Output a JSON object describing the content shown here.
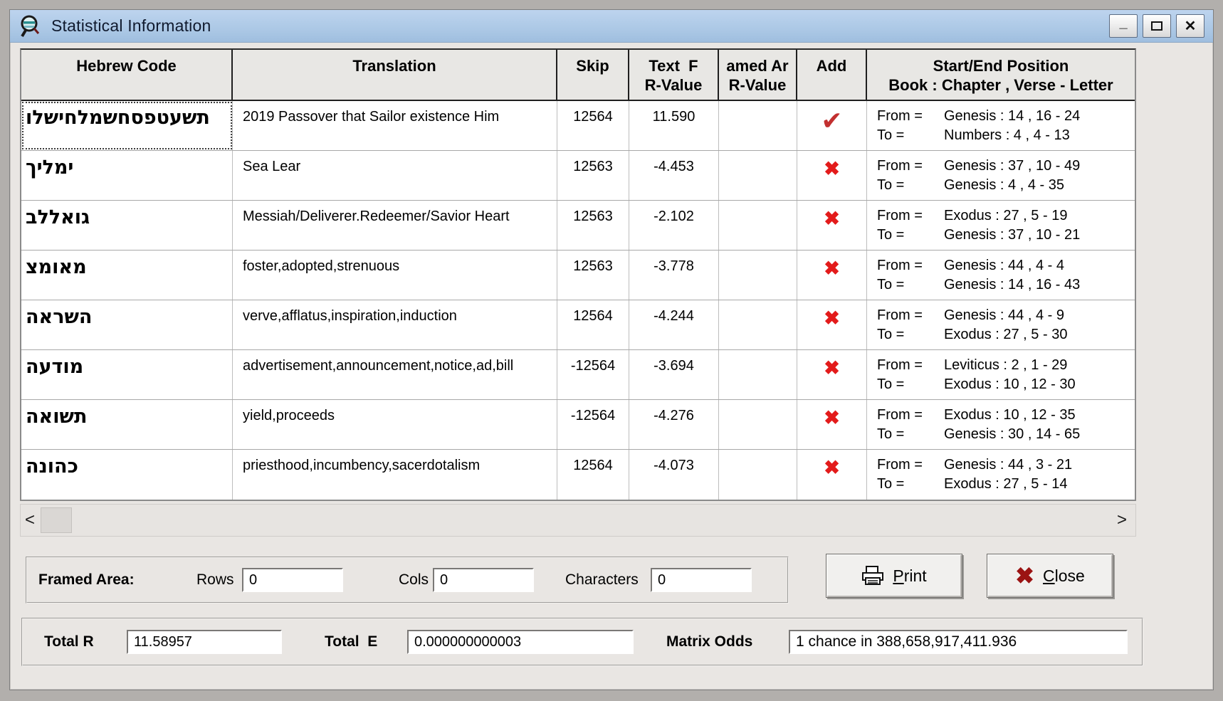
{
  "window": {
    "title": "Statistical Information",
    "controls": {
      "minimize": "_",
      "close": "✕"
    }
  },
  "table": {
    "headers": {
      "hebrew_code": "Hebrew Code",
      "translation": "Translation",
      "skip": "Skip",
      "text_r_line1": "Text  F",
      "text_r_line2": "R-Value",
      "framed_r_line1": "amed Ar",
      "framed_r_line2": "R-Value",
      "add": "Add",
      "position_line1": "Start/End Position",
      "position_line2": "Book : Chapter , Verse - Letter"
    },
    "from_label": "From =",
    "to_label": "To =",
    "rows": [
      {
        "hebrew": "תשעטפסחשמלחישלו",
        "translation": "2019 Passover that Sailor existence Him",
        "skip": "12564",
        "text_r": "11.590",
        "framed_r": "",
        "add_glyph": "✔",
        "add_type": "check",
        "from": "Genesis : 14 , 16 - 24",
        "to": "Numbers : 4 , 4 - 13"
      },
      {
        "hebrew": "ימליך",
        "translation": "Sea Lear",
        "skip": "12563",
        "text_r": "-4.453",
        "framed_r": "",
        "add_glyph": "✖",
        "add_type": "cross",
        "from": "Genesis : 37 , 10 - 49",
        "to": "Genesis : 4 , 4 - 35"
      },
      {
        "hebrew": "גואללב",
        "translation": "Messiah/Deliverer.Redeemer/Savior Heart",
        "skip": "12563",
        "text_r": "-2.102",
        "framed_r": "",
        "add_glyph": "✖",
        "add_type": "cross",
        "from": "Exodus : 27 , 5 - 19",
        "to": "Genesis : 37 , 10 - 21"
      },
      {
        "hebrew": "מאומצ",
        "translation": "foster,adopted,strenuous",
        "skip": "12563",
        "text_r": "-3.778",
        "framed_r": "",
        "add_glyph": "✖",
        "add_type": "cross",
        "from": "Genesis : 44 , 4 - 4",
        "to": "Genesis : 14 , 16 - 43"
      },
      {
        "hebrew": "השראה",
        "translation": "verve,afflatus,inspiration,induction",
        "skip": "12564",
        "text_r": "-4.244",
        "framed_r": "",
        "add_glyph": "✖",
        "add_type": "cross",
        "from": "Genesis : 44 , 4 - 9",
        "to": "Exodus : 27 , 5 - 30"
      },
      {
        "hebrew": "מודעה",
        "translation": "advertisement,announcement,notice,ad,bill",
        "skip": "-12564",
        "text_r": "-3.694",
        "framed_r": "",
        "add_glyph": "✖",
        "add_type": "cross",
        "from": "Leviticus : 2 , 1 - 29",
        "to": "Exodus : 10 , 12 - 30"
      },
      {
        "hebrew": "תשואה",
        "translation": "yield,proceeds",
        "skip": "-12564",
        "text_r": "-4.276",
        "framed_r": "",
        "add_glyph": "✖",
        "add_type": "cross",
        "from": "Exodus : 10 , 12 - 35",
        "to": "Genesis : 30 , 14 - 65"
      },
      {
        "hebrew": "כהונה",
        "translation": "priesthood,incumbency,sacerdotalism",
        "skip": "12564",
        "text_r": "-4.073",
        "framed_r": "",
        "add_glyph": "✖",
        "add_type": "cross",
        "from": "Genesis : 44 , 3 - 21",
        "to": "Exodus : 27 , 5 - 14"
      }
    ]
  },
  "scrollbar": {
    "left_arrow": "<",
    "right_arrow": ">"
  },
  "framed_area": {
    "label": "Framed Area:",
    "rows_label": "Rows",
    "rows_value": "0",
    "cols_label": "Cols",
    "cols_value": "0",
    "chars_label": "Characters",
    "chars_value": "0"
  },
  "buttons": {
    "print": "Print",
    "close": "Close",
    "close_icon": "✖"
  },
  "totals": {
    "total_r_label": "Total R",
    "total_r_value": "11.58957",
    "total_e_label": "Total  E",
    "total_e_value": "0.000000000003",
    "matrix_odds_label": "Matrix Odds",
    "matrix_odds_value": "1 chance in 388,658,917,411.936"
  },
  "colors": {
    "title_bar": "#a9c6e4",
    "check": "#c23030",
    "cross": "#e31b1b",
    "close_x": "#9b1313"
  }
}
